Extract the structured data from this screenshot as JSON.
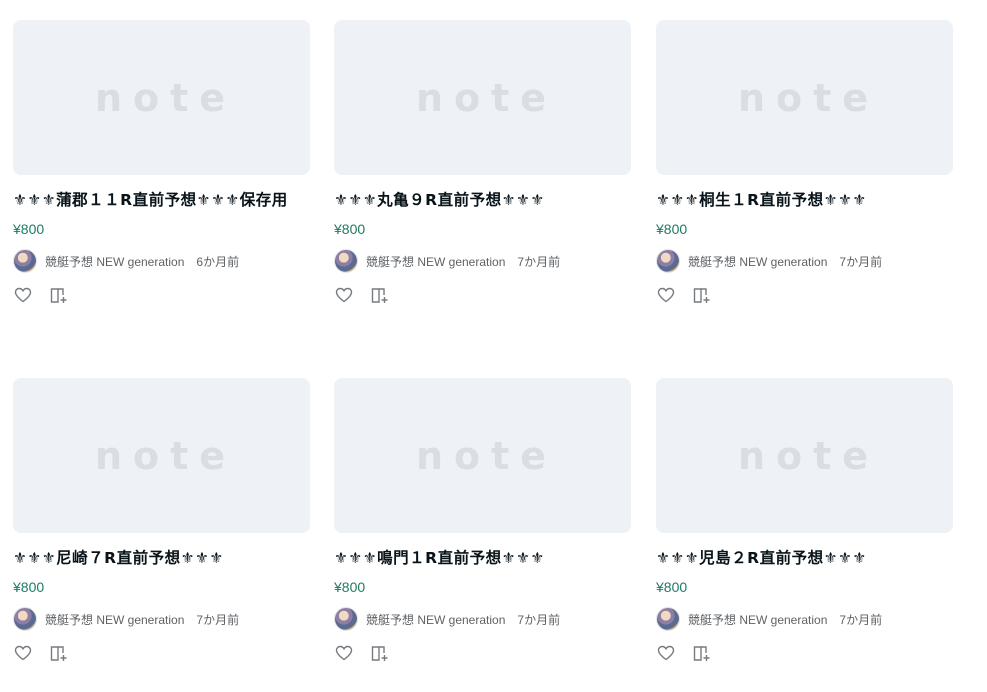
{
  "thumbnail_logo": "note",
  "colors": {
    "price": "#1d7b63",
    "thumb_bg": "#eef1f5",
    "text": "#08131a",
    "muted": "#5e6266"
  },
  "cards": [
    {
      "title": "⚜⚜⚜蒲郡１１R直前予想⚜⚜⚜保存用",
      "price": "¥800",
      "author": "競艇予想 NEW generation",
      "time": "6か月前"
    },
    {
      "title": "⚜⚜⚜丸亀９R直前予想⚜⚜⚜",
      "price": "¥800",
      "author": "競艇予想 NEW generation",
      "time": "7か月前"
    },
    {
      "title": "⚜⚜⚜桐生１R直前予想⚜⚜⚜",
      "price": "¥800",
      "author": "競艇予想 NEW generation",
      "time": "7か月前"
    },
    {
      "title": "⚜⚜⚜尼崎７R直前予想⚜⚜⚜",
      "price": "¥800",
      "author": "競艇予想 NEW generation",
      "time": "7か月前"
    },
    {
      "title": "⚜⚜⚜鳴門１R直前予想⚜⚜⚜",
      "price": "¥800",
      "author": "競艇予想 NEW generation",
      "time": "7か月前"
    },
    {
      "title": "⚜⚜⚜児島２R直前予想⚜⚜⚜",
      "price": "¥800",
      "author": "競艇予想 NEW generation",
      "time": "7か月前"
    }
  ],
  "icons": {
    "like": "heart-outline-icon",
    "magazine": "magazine-add-icon"
  }
}
